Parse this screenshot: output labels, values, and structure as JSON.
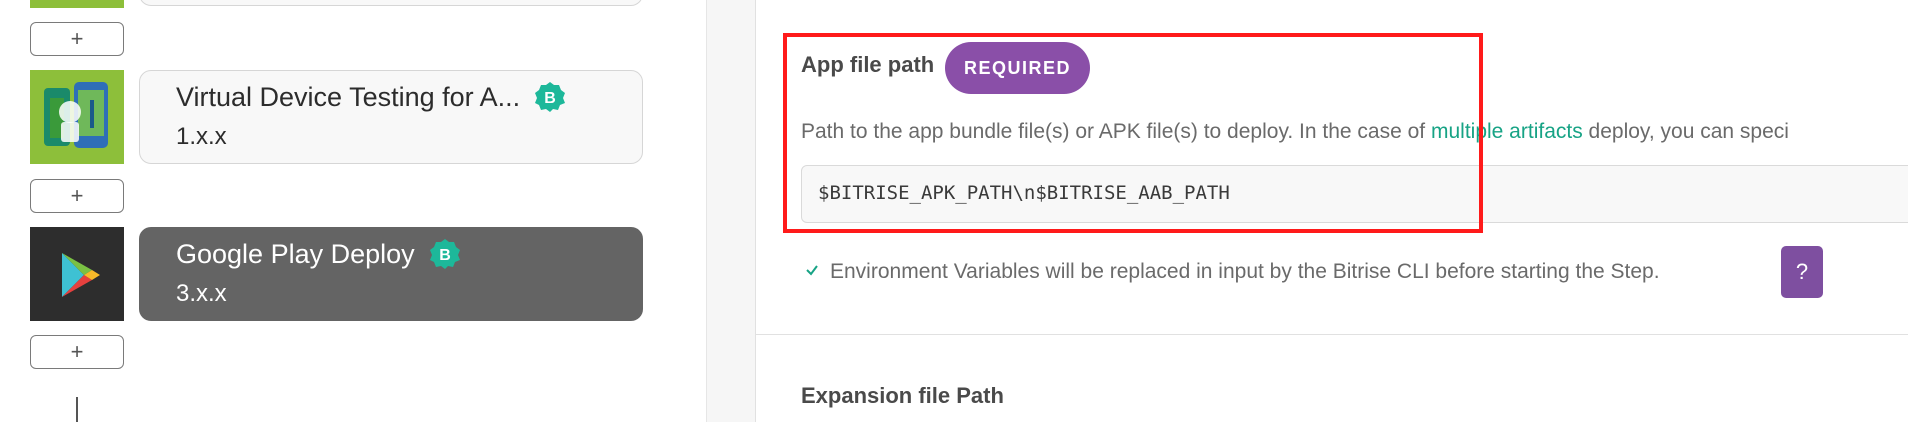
{
  "workflow": {
    "add_step_label": "+",
    "steps": [
      {
        "title": "Virtual Device Testing for A...",
        "version": "1.x.x",
        "badge": "B",
        "selected": false
      },
      {
        "title": "Google Play Deploy",
        "version": "3.x.x",
        "badge": "B",
        "selected": true
      }
    ]
  },
  "settings": {
    "field_label": "App file path",
    "required_label": "REQUIRED",
    "description_prefix": "Path to the app bundle file(s) or APK file(s) to deploy. In the case of ",
    "description_link": "multiple artifacts",
    "description_suffix": " deploy, you can speci",
    "field_value": "$BITRISE_APK_PATH\\n$BITRISE_AAB_PATH",
    "env_note": "Environment Variables will be replaced in input by the Bitrise CLI before starting the Step.",
    "help_label": "?",
    "next_field_label": "Expansion file Path"
  },
  "colors": {
    "accent_purple": "#8a4fa8",
    "link_green": "#17a385",
    "badge_teal": "#1db89a",
    "highlight_red": "#ff1a1a",
    "selected_card": "#646464"
  },
  "icons": {
    "verified_badge": "verified-badge-icon",
    "android_step": "android-device-icon",
    "play_step": "google-play-icon",
    "check": "check-icon"
  }
}
